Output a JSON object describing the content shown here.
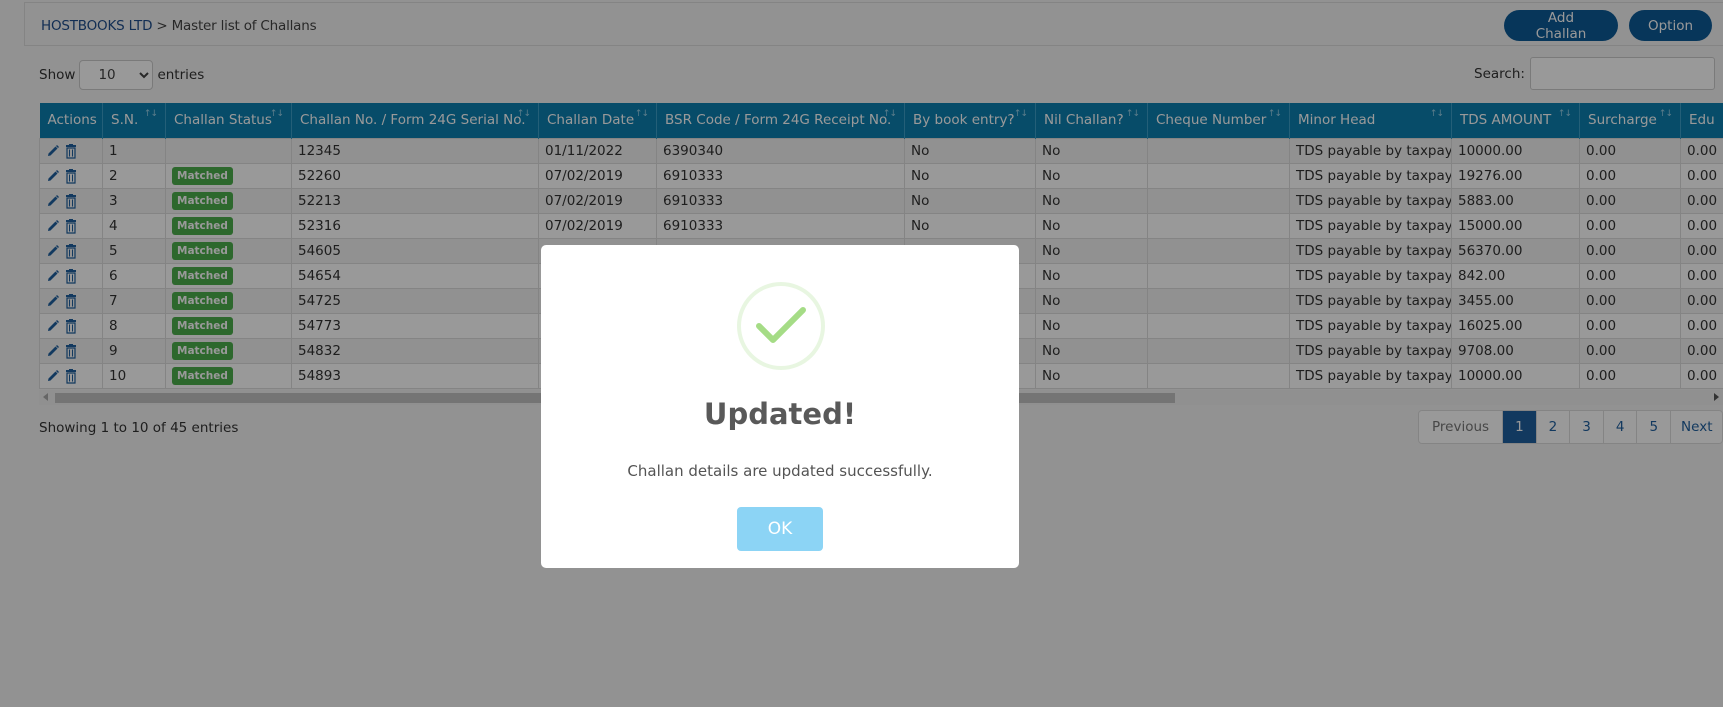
{
  "header": {
    "breadcrumb_home": "HOSTBOOKS LTD",
    "breadcrumb_sep": ">",
    "breadcrumb_current": "Master list of Challans",
    "add_button": "Add Challan",
    "option_button": "Option"
  },
  "controls": {
    "show_label": "Show",
    "entries_label": "entries",
    "page_size": "10",
    "search_label": "Search:",
    "search_value": ""
  },
  "table": {
    "columns": [
      "Actions",
      "S.N.",
      "Challan Status",
      "Challan No. / Form 24G Serial No.",
      "Challan Date",
      "BSR Code / Form 24G Receipt No.",
      "By book entry?",
      "Nil Challan?",
      "Cheque Number",
      "Minor Head",
      "TDS AMOUNT",
      "Surcharge",
      "Edu"
    ],
    "rows": [
      {
        "sn": "1",
        "status": "",
        "challan_no": "12345",
        "date": "01/11/2022",
        "bsr": "6390340",
        "book_entry": "No",
        "nil": "No",
        "cheque": "",
        "minor_head": "TDS payable by taxpayer",
        "tds": "10000.00",
        "surcharge": "0.00",
        "edu": "0.00"
      },
      {
        "sn": "2",
        "status": "Matched",
        "challan_no": "52260",
        "date": "07/02/2019",
        "bsr": "6910333",
        "book_entry": "No",
        "nil": "No",
        "cheque": "",
        "minor_head": "TDS payable by taxpayer",
        "tds": "19276.00",
        "surcharge": "0.00",
        "edu": "0.00"
      },
      {
        "sn": "3",
        "status": "Matched",
        "challan_no": "52213",
        "date": "07/02/2019",
        "bsr": "6910333",
        "book_entry": "No",
        "nil": "No",
        "cheque": "",
        "minor_head": "TDS payable by taxpayer",
        "tds": "5883.00",
        "surcharge": "0.00",
        "edu": "0.00"
      },
      {
        "sn": "4",
        "status": "Matched",
        "challan_no": "52316",
        "date": "07/02/2019",
        "bsr": "6910333",
        "book_entry": "No",
        "nil": "No",
        "cheque": "",
        "minor_head": "TDS payable by taxpayer",
        "tds": "15000.00",
        "surcharge": "0.00",
        "edu": "0.00"
      },
      {
        "sn": "5",
        "status": "Matched",
        "challan_no": "54605",
        "date": "",
        "bsr": "",
        "book_entry": "",
        "nil": "No",
        "cheque": "",
        "minor_head": "TDS payable by taxpayer",
        "tds": "56370.00",
        "surcharge": "0.00",
        "edu": "0.00"
      },
      {
        "sn": "6",
        "status": "Matched",
        "challan_no": "54654",
        "date": "",
        "bsr": "",
        "book_entry": "",
        "nil": "No",
        "cheque": "",
        "minor_head": "TDS payable by taxpayer",
        "tds": "842.00",
        "surcharge": "0.00",
        "edu": "0.00"
      },
      {
        "sn": "7",
        "status": "Matched",
        "challan_no": "54725",
        "date": "",
        "bsr": "",
        "book_entry": "",
        "nil": "No",
        "cheque": "",
        "minor_head": "TDS payable by taxpayer",
        "tds": "3455.00",
        "surcharge": "0.00",
        "edu": "0.00"
      },
      {
        "sn": "8",
        "status": "Matched",
        "challan_no": "54773",
        "date": "",
        "bsr": "",
        "book_entry": "",
        "nil": "No",
        "cheque": "",
        "minor_head": "TDS payable by taxpayer",
        "tds": "16025.00",
        "surcharge": "0.00",
        "edu": "0.00"
      },
      {
        "sn": "9",
        "status": "Matched",
        "challan_no": "54832",
        "date": "",
        "bsr": "",
        "book_entry": "",
        "nil": "No",
        "cheque": "",
        "minor_head": "TDS payable by taxpayer",
        "tds": "9708.00",
        "surcharge": "0.00",
        "edu": "0.00"
      },
      {
        "sn": "10",
        "status": "Matched",
        "challan_no": "54893",
        "date": "",
        "bsr": "",
        "book_entry": "",
        "nil": "No",
        "cheque": "",
        "minor_head": "TDS payable by taxpayer",
        "tds": "10000.00",
        "surcharge": "0.00",
        "edu": "0.00"
      }
    ]
  },
  "footer": {
    "info": "Showing 1 to 10 of 45 entries",
    "pagination": {
      "previous": "Previous",
      "pages": [
        "1",
        "2",
        "3",
        "4",
        "5"
      ],
      "active_page": "1",
      "next": "Next"
    }
  },
  "modal": {
    "icon": "success-check-icon",
    "title": "Updated!",
    "message": "Challan details are updated successfully.",
    "ok_button": "OK"
  },
  "colors": {
    "table_header": "#0c7fb0",
    "primary_button": "#0d5a96",
    "badge_matched": "#4cae4c",
    "success_check": "#a5dc86",
    "ok_button": "#8cd4f5"
  }
}
